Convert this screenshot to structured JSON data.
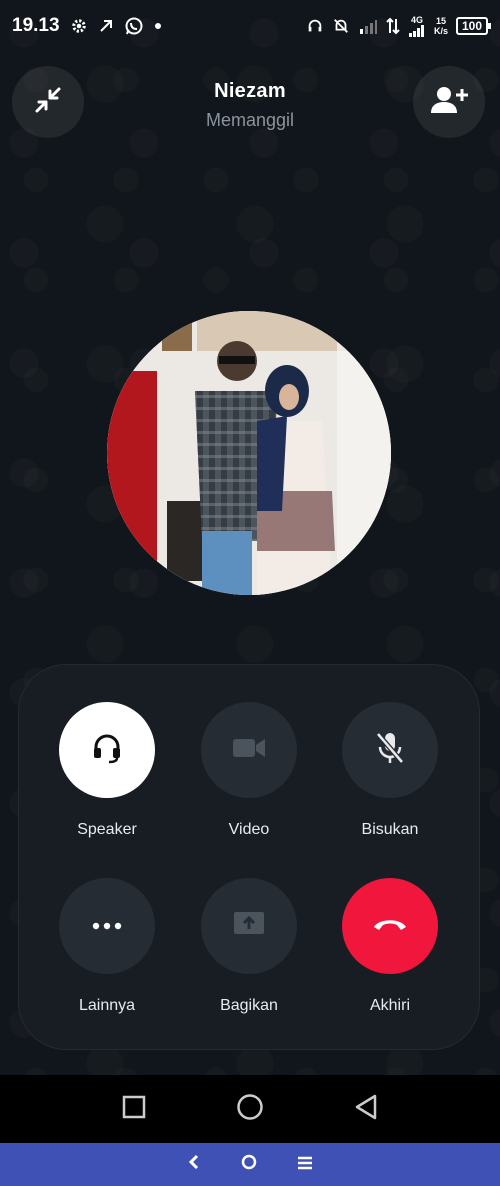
{
  "status_bar": {
    "time": "19.13",
    "network_speed_value": "15",
    "network_speed_unit": "K/s",
    "network_type": "4G",
    "battery": "100"
  },
  "call": {
    "name": "Niezam",
    "status": "Memanggil"
  },
  "controls": {
    "speaker": "Speaker",
    "video": "Video",
    "mute": "Bisukan",
    "more": "Lainnya",
    "share": "Bagikan",
    "end": "Akhiri"
  },
  "colors": {
    "background": "#11161c",
    "panel": "#181d23",
    "button": "#262c33",
    "active_button": "#ffffff",
    "end_call": "#f0163c",
    "bottom_bar": "#3f51b5"
  },
  "icons": {
    "minimize": "minimize-arrows-icon",
    "add_participant": "add-person-icon",
    "speaker": "headset-icon",
    "video": "video-camera-icon",
    "mute": "mic-off-icon",
    "more": "more-dots-icon",
    "share": "share-screen-icon",
    "end": "hang-up-icon"
  }
}
